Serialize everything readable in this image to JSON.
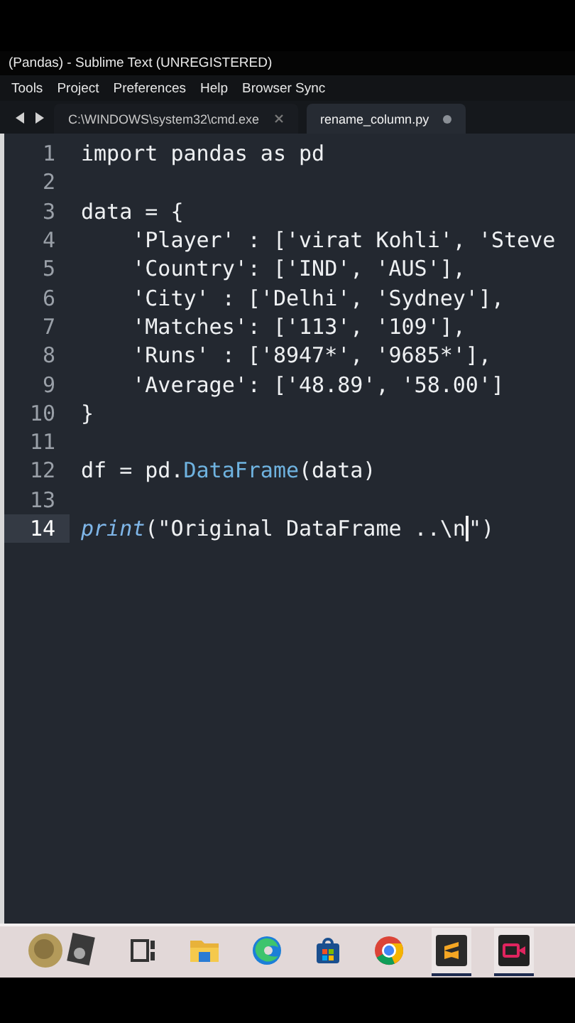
{
  "window": {
    "title": "(Pandas) - Sublime Text (UNREGISTERED)"
  },
  "menu": [
    "Tools",
    "Project",
    "Preferences",
    "Help",
    "Browser Sync"
  ],
  "tabs": [
    {
      "label": "C:\\WINDOWS\\system32\\cmd.exe",
      "selected": false,
      "dirty": false
    },
    {
      "label": "rename_column.py",
      "selected": true,
      "dirty": true
    }
  ],
  "editor": {
    "lines": [
      {
        "number": "1",
        "current": false,
        "tokens": [
          {
            "kind": "plain",
            "text": "import pandas as pd"
          }
        ]
      },
      {
        "number": "2",
        "current": false
      },
      {
        "number": "3",
        "current": false,
        "tokens": [
          {
            "kind": "plain",
            "text": "data = {"
          }
        ]
      },
      {
        "number": "4",
        "current": false,
        "tokens": [
          {
            "kind": "plain",
            "text": "    'Player' : ['virat Kohli', 'Steve"
          }
        ]
      },
      {
        "number": "5",
        "current": false,
        "tokens": [
          {
            "kind": "plain",
            "text": "    'Country': ['IND', 'AUS'],"
          }
        ]
      },
      {
        "number": "6",
        "current": false,
        "tokens": [
          {
            "kind": "plain",
            "text": "    'City' : ['Delhi', 'Sydney'],"
          }
        ]
      },
      {
        "number": "7",
        "current": false,
        "tokens": [
          {
            "kind": "plain",
            "text": "    'Matches': ['113', '109'],"
          }
        ]
      },
      {
        "number": "8",
        "current": false,
        "tokens": [
          {
            "kind": "plain",
            "text": "    'Runs' : ['8947*', '9685*'],"
          }
        ]
      },
      {
        "number": "9",
        "current": false,
        "tokens": [
          {
            "kind": "plain",
            "text": "    'Average': ['48.89', '58.00']"
          }
        ]
      },
      {
        "number": "10",
        "current": false,
        "tokens": [
          {
            "kind": "plain",
            "text": "}"
          }
        ]
      },
      {
        "number": "11",
        "current": false
      },
      {
        "number": "12",
        "current": false,
        "tokens": [
          {
            "kind": "plain",
            "text": "df = pd."
          },
          {
            "kind": "class",
            "text": "DataFrame"
          },
          {
            "kind": "plain",
            "text": "(data)"
          }
        ]
      },
      {
        "number": "13",
        "current": false
      },
      {
        "number": "14",
        "current": true,
        "tokens": [
          {
            "kind": "builtin",
            "text": "print"
          },
          {
            "kind": "plain",
            "text": "(\"Original DataFrame ..\\n"
          },
          {
            "kind": "caret"
          },
          {
            "kind": "plain",
            "text": "\")"
          }
        ]
      }
    ]
  },
  "taskbar": {
    "apps": [
      {
        "kind": "medal",
        "active": false
      },
      {
        "kind": "taskview",
        "active": false
      },
      {
        "kind": "folder",
        "active": false
      },
      {
        "kind": "edge",
        "active": false
      },
      {
        "kind": "store",
        "active": false
      },
      {
        "kind": "chrome",
        "active": false
      },
      {
        "kind": "sublime",
        "active": true
      },
      {
        "kind": "recorder",
        "active": true
      }
    ]
  }
}
